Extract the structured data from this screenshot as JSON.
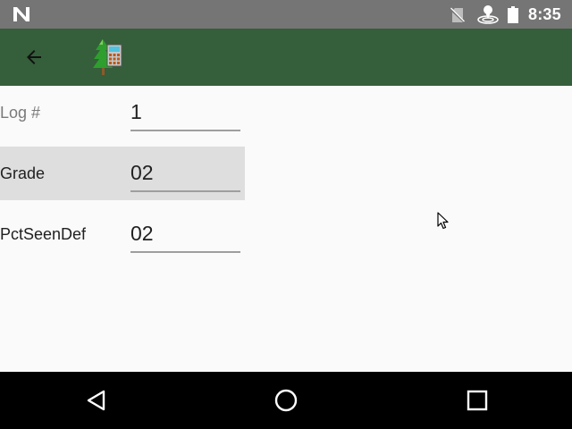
{
  "status_bar": {
    "left_icon": "n-notification-icon",
    "icons": [
      "no-sim-icon",
      "hotspot-icon",
      "battery-icon"
    ],
    "time": "8:35"
  },
  "app_bar": {
    "background_color": "#355e3b",
    "back_icon": "arrow-back-icon",
    "logo_icon": "tree-calculator-logo-icon"
  },
  "form": {
    "rows": [
      {
        "label": "Log #",
        "value": "1",
        "highlighted": false
      },
      {
        "label": "Grade",
        "value": "02",
        "highlighted": true
      },
      {
        "label": "PctSeenDef",
        "value": "02",
        "highlighted": false
      }
    ]
  },
  "nav_bar": {
    "buttons": [
      "back-triangle-icon",
      "home-circle-icon",
      "recents-square-icon"
    ]
  }
}
